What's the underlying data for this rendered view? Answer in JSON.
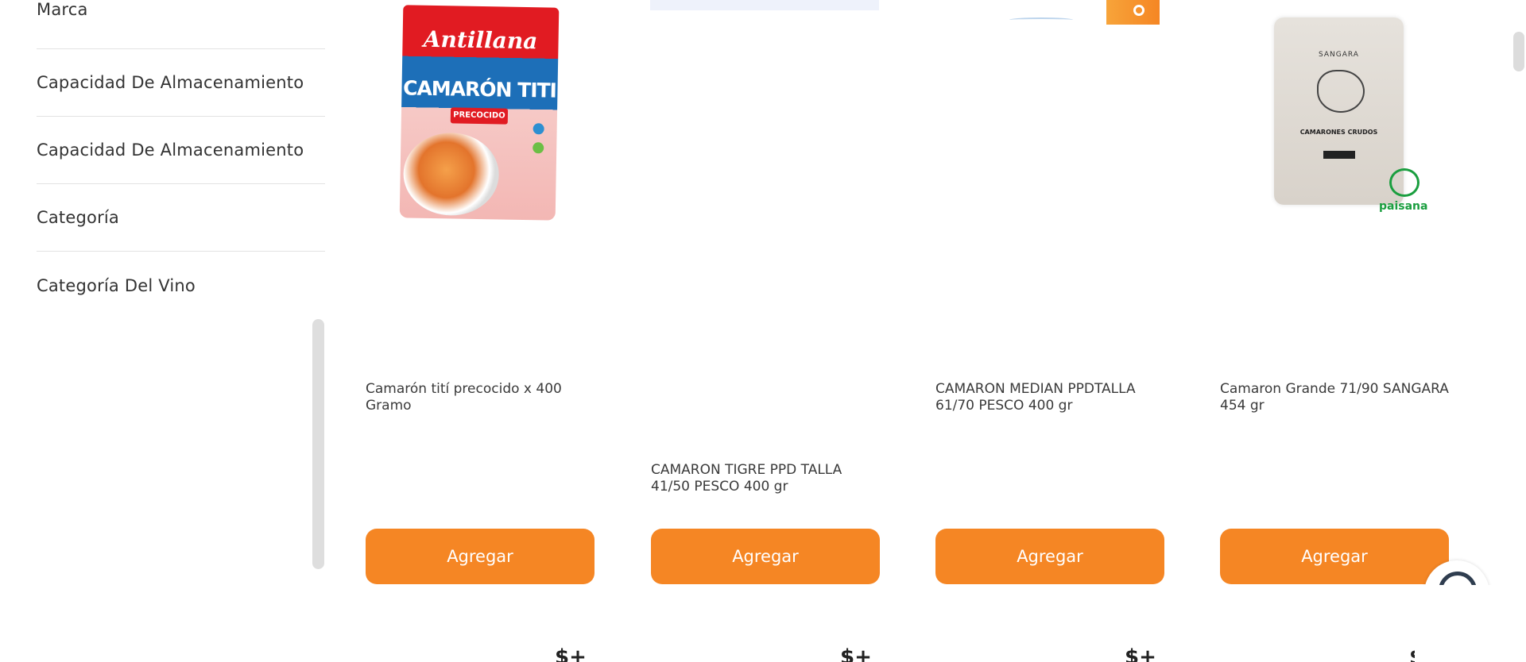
{
  "sidebar": {
    "filters": [
      "Marca",
      "Capacidad De Almacenamiento",
      "Capacidad De Almacenamiento",
      "Categoría",
      "Categoría Del Vino"
    ]
  },
  "products": [
    {
      "name": "Camarón tití precocido x 400 Gramo",
      "button": "Agregar",
      "price_fragment": "$+",
      "image": {
        "brand": "Antillana",
        "title": "CAMARÓN TITI",
        "subtitle": "PRECOCIDO"
      }
    },
    {
      "name": "CAMARON TIGRE PPD TALLA 41/50 PESCO 400 gr",
      "button": "Agregar",
      "price_fragment": "$+"
    },
    {
      "name": "CAMARON MEDIAN PPDTALLA 61/70 PESCO 400 gr",
      "button": "Agregar",
      "price_fragment": "$+"
    },
    {
      "name": "Camaron Grande 71/90 SANGARA 454 gr",
      "button": "Agregar",
      "price_fragment": "$+",
      "image": {
        "brand": "SANGARA",
        "title": "CAMARONES CRUDOS",
        "logo": "paisana"
      }
    }
  ],
  "colors": {
    "accent": "#f58624",
    "button_text": "#ffffff"
  },
  "icons": {
    "help": "help-chat-icon"
  }
}
